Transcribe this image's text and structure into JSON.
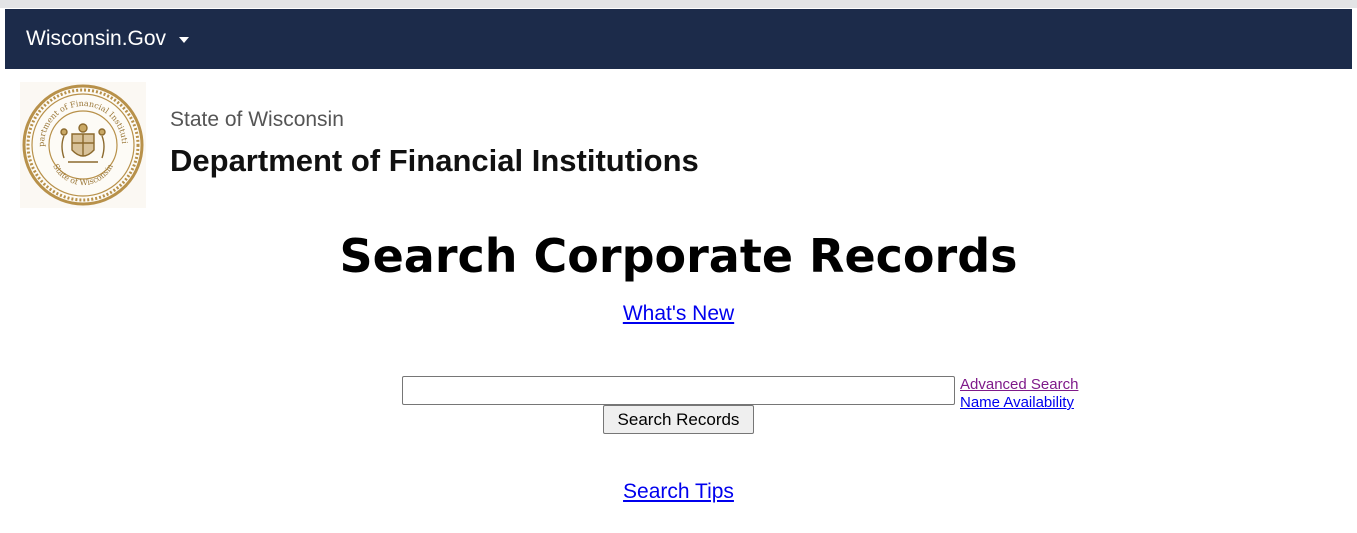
{
  "navbar": {
    "brand": "Wisconsin.Gov"
  },
  "header": {
    "seal_text_top": "Department of Financial Institutions",
    "seal_text_bottom": "State of Wisconsin",
    "state_name": "State of Wisconsin",
    "department_name": "Department of Financial Institutions"
  },
  "main": {
    "title": "Search Corporate Records",
    "whats_new_link": "What's New",
    "search": {
      "value": "",
      "placeholder": "",
      "button_label": "Search Records"
    },
    "advanced_search_link": "Advanced Search",
    "name_availability_link": "Name Availability",
    "search_tips_link": "Search Tips"
  },
  "colors": {
    "navbar_bg": "#1c2b4a",
    "link": "#0000ee",
    "visited_link": "#7f1a8a",
    "seal_gold": "#b8914a"
  }
}
